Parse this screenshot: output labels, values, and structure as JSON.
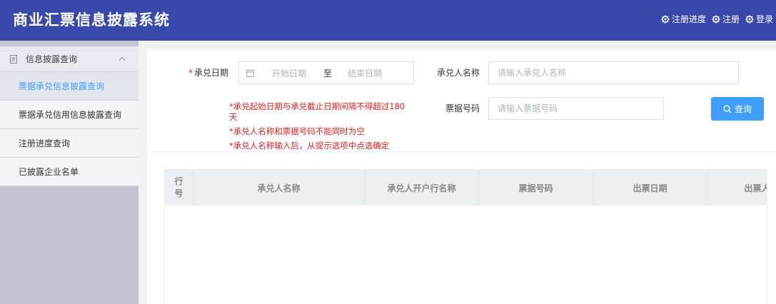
{
  "header": {
    "title": "商业汇票信息披露系统",
    "links": [
      {
        "label": "注册进度",
        "icon": "gear-icon"
      },
      {
        "label": "注册",
        "icon": "gear-icon"
      },
      {
        "label": "登录",
        "icon": "gear-icon"
      }
    ]
  },
  "sidebar": {
    "group_label": "信息披露查询",
    "items": [
      {
        "label": "票据承兑信息披露查询",
        "active": true
      },
      {
        "label": "票据承兑信用信息披露查询",
        "active": false
      },
      {
        "label": "注册进度查询",
        "active": false
      },
      {
        "label": "已披露企业名单",
        "active": false
      }
    ]
  },
  "form": {
    "date_label_required": "*",
    "date_label": "承兑日期",
    "date_start_placeholder": "开始日期",
    "date_separator": "至",
    "date_end_placeholder": "结束日期",
    "acceptor_label": "承兑人名称",
    "acceptor_placeholder": "请输入承兑人名称",
    "bill_label": "票据号码",
    "bill_placeholder": "请输入票据号码",
    "search_button": "查询",
    "notes": [
      "*承兑起始日期与承兑截止日期间隔不得超过180",
      "天",
      "*承兑人名称和票据号码不能同时为空",
      "*承兑人名称输入后，从提示选项中点选确定"
    ]
  },
  "table": {
    "columns": [
      "行号",
      "承兑人名称",
      "承兑人开户行名称",
      "票据号码",
      "出票日期",
      "出票人"
    ]
  },
  "colors": {
    "header_bg": "#3949ab",
    "primary": "#409eff",
    "warning_text": "#e02020"
  }
}
